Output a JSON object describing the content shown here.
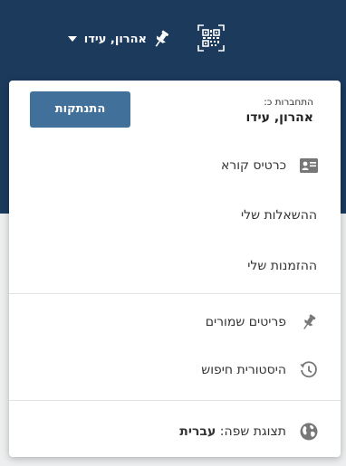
{
  "navbar": {
    "user_name": "אהרון, עידו",
    "qr_icon": "qr-code-icon",
    "pin_icon": "pushpin-icon"
  },
  "colors": {
    "navbar_bg": "#1b3a5c",
    "button_bg": "#41719b",
    "icon_gray": "#777777"
  },
  "dropdown": {
    "login_label": "התחברות כ:",
    "login_name": "אהרון, עידו",
    "logout_label": "התנתקות",
    "items": [
      {
        "label": "כרטיס קורא",
        "icon": "id-card-icon"
      },
      {
        "label": "ההשאלות שלי"
      },
      {
        "label": "ההזמנות שלי"
      },
      {
        "label": "פריטים שמורים",
        "icon": "pushpin-icon"
      },
      {
        "label": "היסטורית חיפוש",
        "icon": "history-icon"
      }
    ],
    "language": {
      "label": "תצוגת שפה: ",
      "value": "עברית",
      "icon": "globe-icon"
    }
  }
}
